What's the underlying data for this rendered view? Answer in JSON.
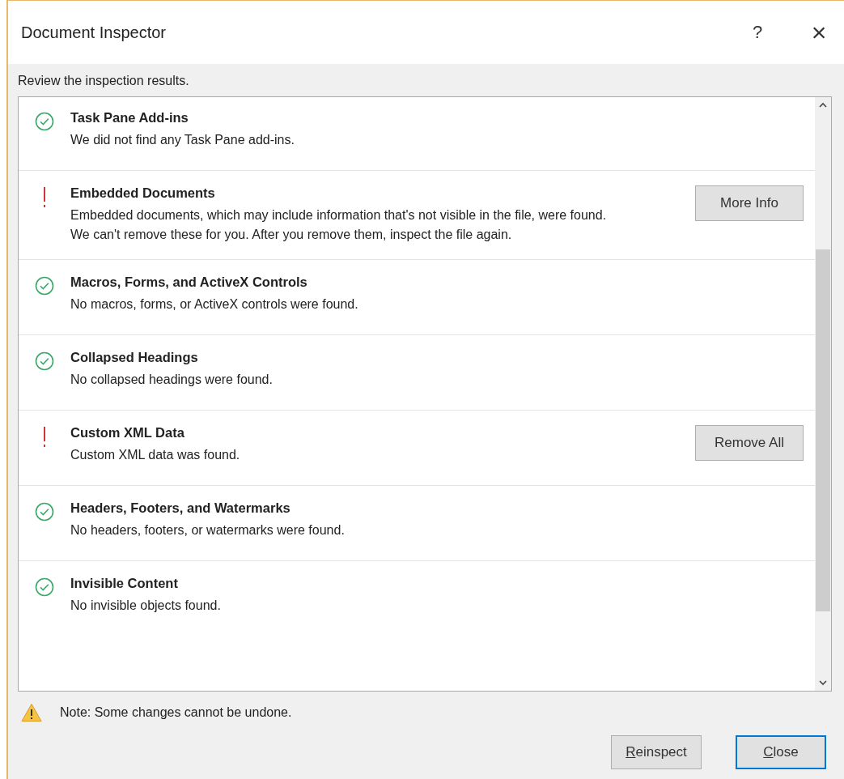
{
  "window": {
    "title": "Document Inspector",
    "help": "?",
    "close": "×"
  },
  "instruction": "Review the inspection results.",
  "results": [
    {
      "kind": "ok",
      "title": "Task Pane Add-ins",
      "message": "We did not find any Task Pane add-ins."
    },
    {
      "kind": "issue",
      "title": "Embedded Documents",
      "message": "Embedded documents, which may include information that's not visible in the file, were found. We can't remove these for you. After you remove them, inspect the file again.",
      "action": "More Info"
    },
    {
      "kind": "ok",
      "title": "Macros, Forms, and ActiveX Controls",
      "message": "No macros, forms, or ActiveX controls were found."
    },
    {
      "kind": "ok",
      "title": "Collapsed Headings",
      "message": "No collapsed headings were found."
    },
    {
      "kind": "issue",
      "title": "Custom XML Data",
      "message": "Custom XML data was found.",
      "action": "Remove All"
    },
    {
      "kind": "ok",
      "title": "Headers, Footers, and Watermarks",
      "message": "No headers, footers, or watermarks were found."
    },
    {
      "kind": "ok",
      "title": "Invisible Content",
      "message": "No invisible objects found."
    }
  ],
  "note": "Note: Some changes cannot be undone.",
  "buttons": [
    {
      "label": "Reinspect",
      "default": false,
      "mnemonic_underlined": true
    },
    {
      "label": "Close",
      "default": true,
      "mnemonic_underlined": true
    }
  ]
}
